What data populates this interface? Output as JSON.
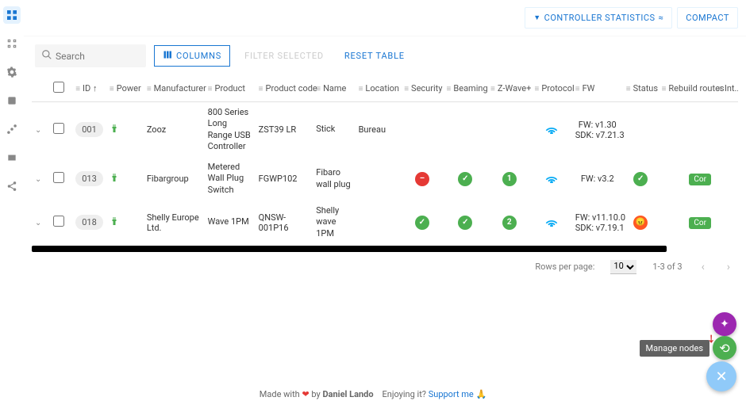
{
  "toolbar": {
    "controller_stats": "CONTROLLER STATISTICS",
    "compact": "COMPACT"
  },
  "controls": {
    "search_placeholder": "Search",
    "columns": "COLUMNS",
    "filter_selected": "FILTER SELECTED",
    "reset": "RESET TABLE"
  },
  "columns": {
    "id": "ID",
    "power": "Power",
    "manufacturer": "Manufacturer",
    "product": "Product",
    "product_code": "Product code",
    "name": "Name",
    "location": "Location",
    "security": "Security",
    "beaming": "Beaming",
    "zwaveplus": "Z-Wave+",
    "protocol": "Protocol",
    "fw": "FW",
    "status": "Status",
    "rebuild": "Rebuild routes",
    "interview": "Int..."
  },
  "rows": [
    {
      "id": "001",
      "manufacturer": "Zooz",
      "product": "800 Series Long Range USB Controller",
      "product_code": "ZST39 LR",
      "name": "Stick",
      "location": "Bureau",
      "security": "",
      "beaming": "",
      "zwaveplus": "",
      "protocol": "wave",
      "fw": "FW: v1.30\nSDK: v7.21.3",
      "status": "",
      "rebuild": ""
    },
    {
      "id": "013",
      "manufacturer": "Fibargroup",
      "product": "Metered Wall Plug Switch",
      "product_code": "FGWP102",
      "name": "Fibaro wall plug",
      "location": "",
      "security": "minus",
      "beaming": "check",
      "zwaveplus": "1",
      "protocol": "wave",
      "fw": "FW: v3.2",
      "status": "ok",
      "rebuild": "Cor"
    },
    {
      "id": "018",
      "manufacturer": "Shelly Europe Ltd.",
      "product": "Wave 1PM",
      "product_code": "QNSW-001P16",
      "name": "Shelly wave 1PM",
      "location": "",
      "security": "check",
      "beaming": "check",
      "zwaveplus": "2",
      "protocol": "wave",
      "fw": "FW: v11.10.0\nSDK: v7.19.1",
      "status": "bad",
      "rebuild": "Cor"
    }
  ],
  "pagination": {
    "rows_per_page_label": "Rows per page:",
    "rows_per_page": "10",
    "range": "1-3 of 3"
  },
  "tooltip": "Manage nodes",
  "credit": {
    "prefix": "Made with",
    "by": "by",
    "author": "Daniel Lando",
    "enjoy": "Enjoying it?",
    "support": "Support me"
  }
}
